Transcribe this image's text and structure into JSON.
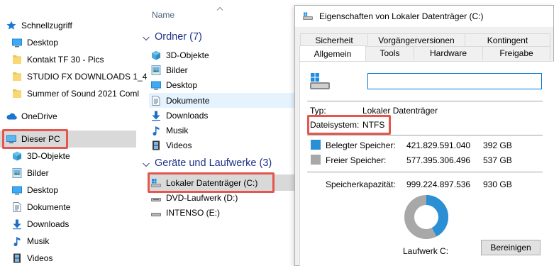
{
  "nav": {
    "items": [
      {
        "label": "Schnellzugriff",
        "icon": "star-icon"
      },
      {
        "label": "Desktop",
        "icon": "desktop-icon"
      },
      {
        "label": "Kontakt TF 30 - Pics",
        "icon": "folder-icon"
      },
      {
        "label": "STUDIO FX DOWNLOADS 1_4",
        "icon": "folder-icon"
      },
      {
        "label": "Summer of Sound 2021 Coml",
        "icon": "folder-icon"
      },
      {
        "label": "OneDrive",
        "icon": "cloud-icon"
      },
      {
        "label": "Dieser PC",
        "icon": "computer-icon"
      },
      {
        "label": "3D-Objekte",
        "icon": "cube-icon"
      },
      {
        "label": "Bilder",
        "icon": "pictures-icon"
      },
      {
        "label": "Desktop",
        "icon": "desktop-icon"
      },
      {
        "label": "Dokumente",
        "icon": "documents-icon"
      },
      {
        "label": "Downloads",
        "icon": "download-arrow-icon"
      },
      {
        "label": "Musik",
        "icon": "music-note-icon"
      },
      {
        "label": "Videos",
        "icon": "film-icon"
      }
    ]
  },
  "content": {
    "column_name": "Name",
    "groups": {
      "folders": {
        "title": "Ordner (7)",
        "items": [
          {
            "label": "3D-Objekte",
            "icon": "cube-icon"
          },
          {
            "label": "Bilder",
            "icon": "pictures-icon"
          },
          {
            "label": "Desktop",
            "icon": "desktop-icon"
          },
          {
            "label": "Dokumente",
            "icon": "documents-icon"
          },
          {
            "label": "Downloads",
            "icon": "download-arrow-icon"
          },
          {
            "label": "Musik",
            "icon": "music-note-icon"
          },
          {
            "label": "Videos",
            "icon": "film-icon"
          }
        ]
      },
      "drives": {
        "title": "Geräte und Laufwerke (3)",
        "items": [
          {
            "label": "Lokaler Datenträger (C:)",
            "icon": "windows-drive-icon"
          },
          {
            "label": "DVD-Laufwerk (D:)",
            "icon": "dvd-drive-icon"
          },
          {
            "label": "INTENSO (E:)",
            "icon": "usb-drive-icon"
          }
        ]
      }
    }
  },
  "dialog": {
    "title": "Eigenschaften von Lokaler Datenträger (C:)",
    "tabs_row1": [
      "Sicherheit",
      "Vorgängerversionen",
      "Kontingent"
    ],
    "tabs_row2": [
      "Allgemein",
      "Tools",
      "Hardware",
      "Freigabe"
    ],
    "name_value": "",
    "type_label": "Typ:",
    "type_value": "Lokaler Datenträger",
    "fs_label": "Dateisystem:",
    "fs_value": "NTFS",
    "used_label": "Belegter Speicher:",
    "used_bytes": "421.829.591.040",
    "used_gb": "392 GB",
    "free_label": "Freier Speicher:",
    "free_bytes": "577.395.306.496",
    "free_gb": "537 GB",
    "capacity_label": "Speicherkapazität:",
    "capacity_bytes": "999.224.897.536",
    "capacity_gb": "930 GB",
    "used_fraction": 0.422,
    "drive_label": "Laufwerk C:",
    "cleanup_button": "Bereinigen",
    "colors": {
      "used": "#2b8fd6",
      "free": "#a8a8a8",
      "accent": "#0078d7",
      "highlight": "#e4564e"
    }
  }
}
